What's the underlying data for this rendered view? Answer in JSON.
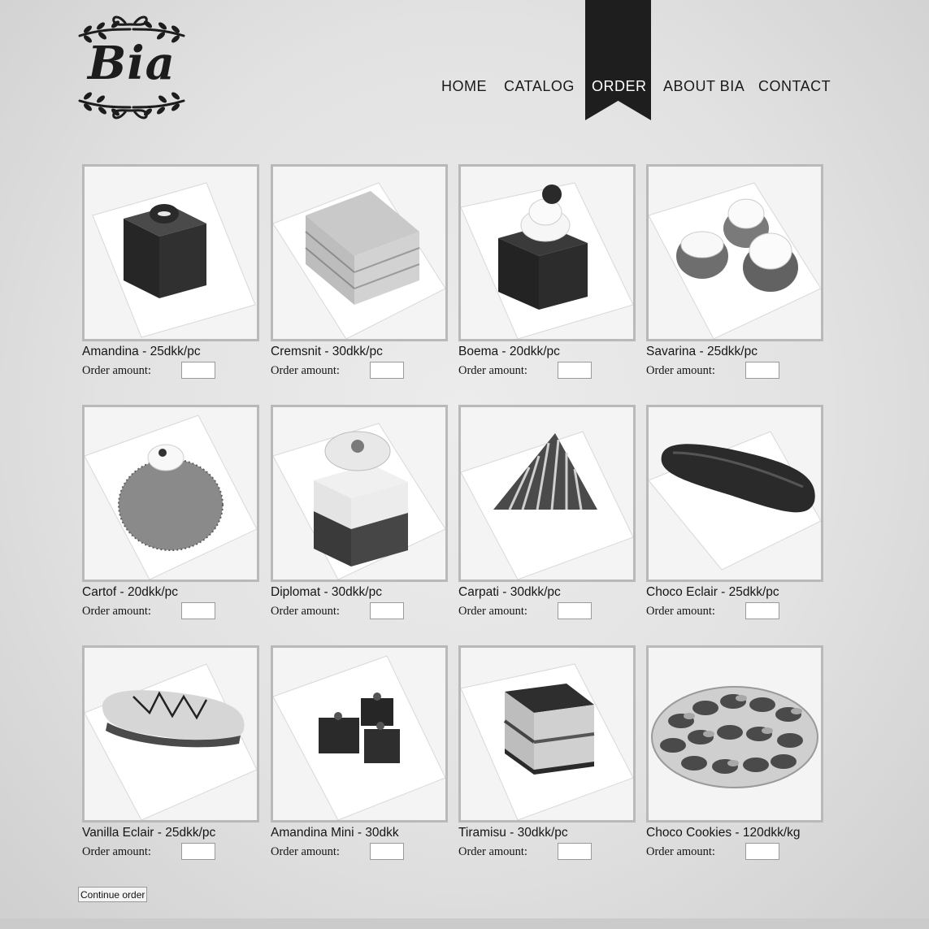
{
  "brand": {
    "logo_text": "Bia"
  },
  "nav": {
    "items": [
      {
        "label": "HOME",
        "active": false
      },
      {
        "label": "CATALOG",
        "active": false
      },
      {
        "label": "ORDER",
        "active": true
      },
      {
        "label": "ABOUT BIA",
        "active": false
      },
      {
        "label": "CONTACT",
        "active": false
      }
    ]
  },
  "order": {
    "amount_label": "Order amount:",
    "products": [
      {
        "title": "Amandina - 25dkk/pc",
        "amount": "",
        "image": "amandina-photo"
      },
      {
        "title": "Cremsnit - 30dkk/pc",
        "amount": "",
        "image": "cremsnit-photo"
      },
      {
        "title": "Boema - 20dkk/pc",
        "amount": "",
        "image": "boema-photo"
      },
      {
        "title": "Savarina - 25dkk/pc",
        "amount": "",
        "image": "savarina-photo"
      },
      {
        "title": "Cartof - 20dkk/pc",
        "amount": "",
        "image": "cartof-photo"
      },
      {
        "title": "Diplomat - 30dkk/pc",
        "amount": "",
        "image": "diplomat-photo"
      },
      {
        "title": "Carpati - 30dkk/pc",
        "amount": "",
        "image": "carpati-photo"
      },
      {
        "title": "Choco Eclair - 25dkk/pc",
        "amount": "",
        "image": "choco-eclair-photo"
      },
      {
        "title": "Vanilla Eclair - 25dkk/pc",
        "amount": "",
        "image": "vanilla-eclair-photo"
      },
      {
        "title": "Amandina Mini - 30dkk",
        "amount": "",
        "image": "amandina-mini-photo"
      },
      {
        "title": "Tiramisu - 30dkk/pc",
        "amount": "",
        "image": "tiramisu-photo"
      },
      {
        "title": "Choco Cookies - 120dkk/kg",
        "amount": "",
        "image": "choco-cookies-photo"
      }
    ],
    "continue_label": "Continue order"
  },
  "colors": {
    "ribbon": "#1e1e1e",
    "text": "#1a1a1a",
    "frame_border": "#b9b9b9"
  }
}
